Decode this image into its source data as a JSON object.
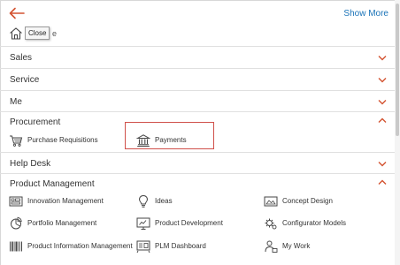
{
  "header": {
    "show_more_label": "Show More",
    "back_icon": "arrow-left-icon",
    "accent_color": "#d35230",
    "link_color": "#1a73b8"
  },
  "home": {
    "icon": "home-icon",
    "tooltip_label": "Close",
    "trail": "e"
  },
  "sections": {
    "sales": {
      "label": "Sales",
      "expanded": false
    },
    "service": {
      "label": "Service",
      "expanded": false
    },
    "me": {
      "label": "Me",
      "expanded": false
    },
    "procurement": {
      "label": "Procurement",
      "expanded": true,
      "items": [
        {
          "label": "Purchase Requisitions",
          "icon": "shopping-cart-icon"
        },
        {
          "label": "Payments",
          "icon": "bank-icon",
          "highlighted": true
        }
      ]
    },
    "help_desk": {
      "label": "Help Desk",
      "expanded": false
    },
    "product_management": {
      "label": "Product Management",
      "expanded": true,
      "items": [
        {
          "label": "Innovation Management",
          "icon": "innovation-board-icon"
        },
        {
          "label": "Ideas",
          "icon": "lightbulb-icon"
        },
        {
          "label": "Concept Design",
          "icon": "concept-design-icon"
        },
        {
          "label": "Portfolio Management",
          "icon": "portfolio-icon"
        },
        {
          "label": "Product Development",
          "icon": "product-development-icon"
        },
        {
          "label": "Configurator Models",
          "icon": "configurator-icon"
        },
        {
          "label": "Product Information Management",
          "icon": "barcode-icon"
        },
        {
          "label": "PLM Dashboard",
          "icon": "dashboard-icon"
        },
        {
          "label": "My Work",
          "icon": "my-work-icon"
        }
      ]
    }
  }
}
